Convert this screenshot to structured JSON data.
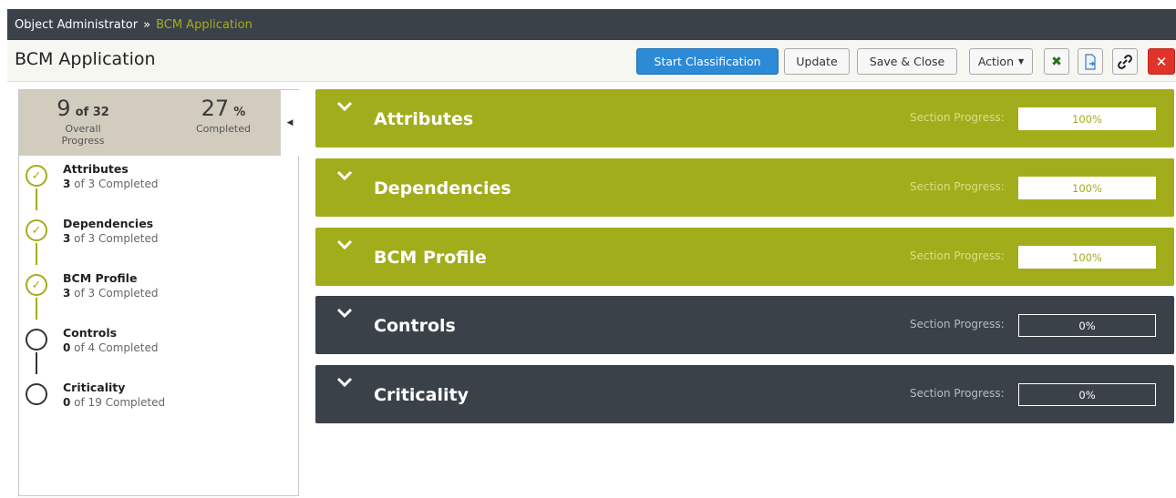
{
  "breadcrumb": {
    "root": "Object Administrator",
    "separator": "»",
    "current": "BCM Application"
  },
  "page_title": "BCM Application",
  "toolbar": {
    "start_classification": "Start Classification",
    "update": "Update",
    "save_close": "Save & Close",
    "action": "Action",
    "icons": [
      "excel-icon",
      "export-document-icon",
      "link-icon",
      "close-icon"
    ],
    "close_glyph": "✕",
    "excel_glyph": "✖"
  },
  "overall": {
    "completed": "9",
    "of_label": "of 32",
    "overall_label": "Overall Progress",
    "percent": "27",
    "percent_sign": "%",
    "completed_label": "Completed"
  },
  "steps": [
    {
      "name": "Attributes",
      "done_count": "3",
      "rest": " of 3 Completed",
      "done": true
    },
    {
      "name": "Dependencies",
      "done_count": "3",
      "rest": " of 3 Completed",
      "done": true
    },
    {
      "name": "BCM Profile",
      "done_count": "3",
      "rest": " of 3 Completed",
      "done": true
    },
    {
      "name": "Controls",
      "done_count": "0",
      "rest": " of 4 Completed",
      "done": false
    },
    {
      "name": "Criticality",
      "done_count": "0",
      "rest": " of 19 Completed",
      "done": false
    }
  ],
  "sections": [
    {
      "title": "Attributes",
      "progress_label": "Section Progress:",
      "progress_text": "100%",
      "progress_value": 1.0
    },
    {
      "title": "Dependencies",
      "progress_label": "Section Progress:",
      "progress_text": "100%",
      "progress_value": 1.0
    },
    {
      "title": "BCM Profile",
      "progress_label": "Section Progress:",
      "progress_text": "100%",
      "progress_value": 1.0
    },
    {
      "title": "Controls",
      "progress_label": "Section Progress:",
      "progress_text": "0%",
      "progress_value": 0
    },
    {
      "title": "Criticality",
      "progress_label": "Section Progress:",
      "progress_text": "0%",
      "progress_value": 0
    }
  ],
  "colors": {
    "accent_green": "#a2ad1c",
    "dark_section": "#3a4149",
    "primary_blue": "#2d8ad6",
    "close_red": "#e0342a"
  }
}
